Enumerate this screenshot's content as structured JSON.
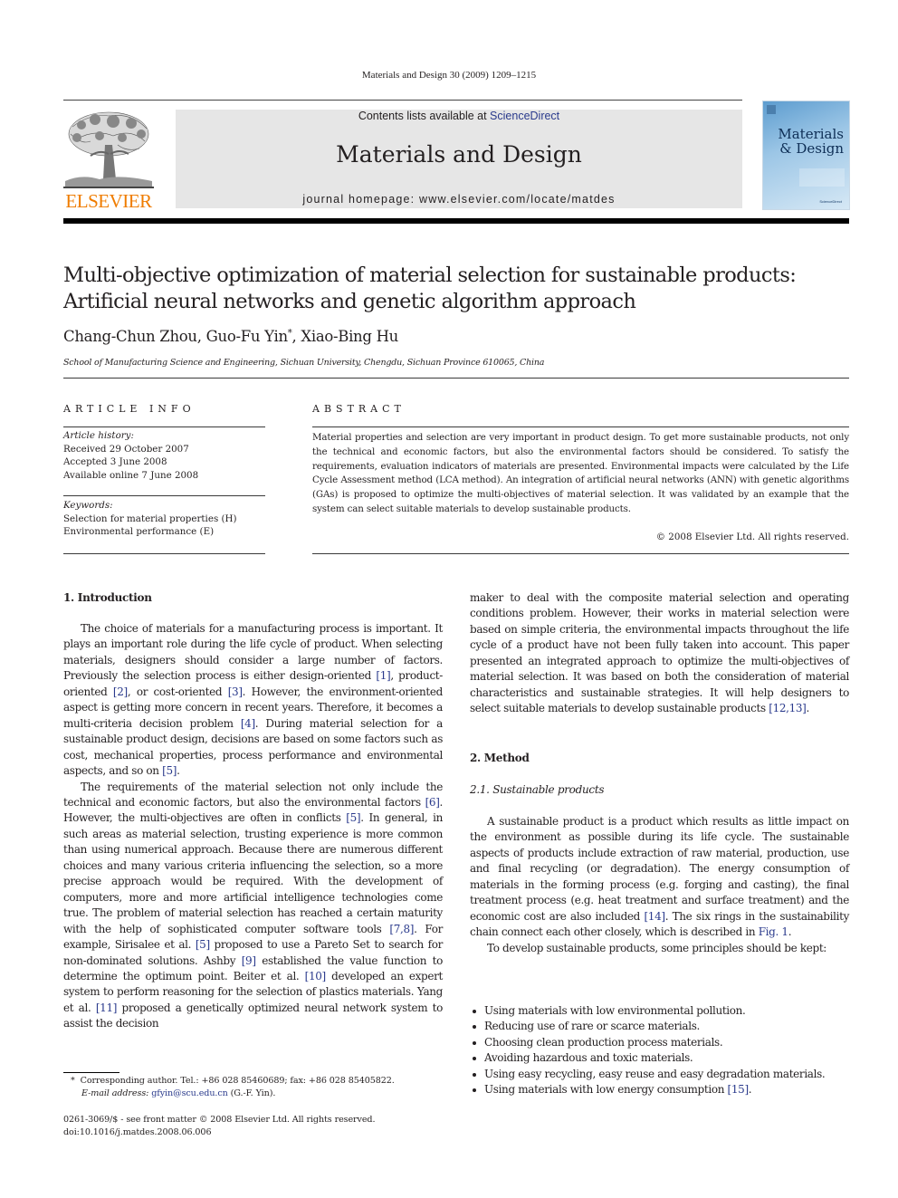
{
  "running_head": "Materials and Design 30 (2009) 1209–1215",
  "masthead": {
    "publisher_logo_text": "ELSEVIER",
    "contents_prefix": "Contents lists available at ",
    "contents_link": "ScienceDirect",
    "journal_name": "Materials and Design",
    "homepage": "journal homepage: www.elsevier.com/locate/matdes",
    "cover_title_line1": "Materials",
    "cover_title_line2": "& Design",
    "cover_publisher": "ScienceDirect",
    "colors": {
      "elsevier_orange": "#ef7c00",
      "link_blue": "#2a3a8c",
      "banner_gray": "#e6e6e6"
    }
  },
  "article": {
    "title_line1": "Multi-objective optimization of material selection for sustainable products:",
    "title_line2": "Artificial neural networks and genetic algorithm approach",
    "authors_before": "Chang-Chun Zhou, Guo-Fu Yin",
    "author_mark": "*",
    "authors_after": ", Xiao-Bing Hu",
    "affiliation": "School of Manufacturing Science and Engineering, Sichuan University, Chengdu, Sichuan Province 610065, China"
  },
  "article_info": {
    "heading": "ARTICLE INFO",
    "history_label": "Article history:",
    "history": [
      "Received 29 October 2007",
      "Accepted 3 June 2008",
      "Available online 7 June 2008"
    ],
    "keywords_label": "Keywords:",
    "keywords": [
      "Selection for material properties (H)",
      "Environmental performance (E)"
    ]
  },
  "abstract": {
    "heading": "ABSTRACT",
    "text": "Material properties and selection are very important in product design. To get more sustainable products, not only the technical and economic factors, but also the environmental factors should be considered. To satisfy the requirements, evaluation indicators of materials are presented. Environmental impacts were calculated by the Life Cycle Assessment method (LCA method). An integration of artificial neural networks (ANN) with genetic algorithms (GAs) is proposed to optimize the multi-objectives of material selection. It was validated by an example that the system can select suitable materials to develop sustainable products.",
    "copyright": "© 2008 Elsevier Ltd. All rights reserved."
  },
  "body": {
    "sec1_heading": "1. Introduction",
    "p1": [
      "The choice of materials for a manufacturing process is important. It plays an important role during the life cycle of product. When selecting materials, designers should consider a large number of factors. Previously the selection process is either design-oriented ",
      "[1]",
      ", product-oriented ",
      "[2]",
      ", or cost-oriented ",
      "[3]",
      ". However, the environment-oriented aspect is getting more concern in recent years. Therefore, it becomes a multi-criteria decision problem ",
      "[4]",
      ". During material selection for a sustainable product design, decisions are based on some factors such as cost, mechanical properties, process performance and environmental aspects, and so on ",
      "[5]",
      "."
    ],
    "p2": [
      "The requirements of the material selection not only include the technical and economic factors, but also the environmental factors ",
      "[6]",
      ". However, the multi-objectives are often in conflicts ",
      "[5]",
      ". In general, in such areas as material selection, trusting experience is more common than using numerical approach. Because there are numerous different choices and many various criteria influencing the selection, so a more precise approach would be required. With the development of computers, more and more artificial intelligence technologies come true. The problem of material selection has reached a certain maturity with the help of sophisticated computer software tools ",
      "[7,8]",
      ". For example, Sirisalee et al. ",
      "[5]",
      " proposed to use a Pareto Set to search for non-dominated solutions. Ashby ",
      "[9]",
      " established the value function to determine the optimum point. Beiter et al. ",
      "[10]",
      " developed an expert system to perform reasoning for the selection of plastics materials. Yang et al. ",
      "[11]",
      " proposed a genetically optimized neural network system to assist the decision"
    ],
    "p3": [
      "maker to deal with the composite material selection and operating conditions problem. However, their works in material selection were based on simple criteria, the environmental impacts throughout the life cycle of a product have not been fully taken into account. This paper presented an integrated approach to optimize the multi-objectives of material selection. It was based on both the consideration of material characteristics and sustainable strategies. It will help designers to select suitable materials to develop sustainable products ",
      "[12,13]",
      "."
    ],
    "sec2_heading": "2. Method",
    "sec21_heading": "2.1. Sustainable products",
    "p4": [
      "A sustainable product is a product which results as little impact on the environment as possible during its life cycle. The sustainable aspects of products include extraction of raw material, production, use and final recycling (or degradation). The energy consumption of materials in the forming process (e.g. forging and casting), the final treatment process (e.g. heat treatment and surface treatment) and the economic cost are also included ",
      "[14]",
      ". The six rings in the sustainability chain connect each other closely, which is described in ",
      "Fig. 1",
      "."
    ],
    "p5": "To develop sustainable products, some principles should be kept:",
    "bullets": [
      [
        "Using materials with low environmental pollution."
      ],
      [
        "Reducing use of rare or scarce materials."
      ],
      [
        "Choosing clean production process materials."
      ],
      [
        "Avoiding hazardous and toxic materials."
      ],
      [
        "Using easy recycling, easy reuse and easy degradation materials."
      ],
      [
        "Using materials with low energy consumption ",
        "[15]",
        "."
      ]
    ]
  },
  "footnote": {
    "mark": "*",
    "corresponding": "Corresponding author. Tel.: +86 028 85460689; fax: +86 028 85405822.",
    "email_label": "E-mail address:",
    "email": "gfyin@scu.edu.cn",
    "email_suffix": " (G.-F. Yin).",
    "issn_line": "0261-3069/$ - see front matter © 2008 Elsevier Ltd. All rights reserved.",
    "doi_line": "doi:10.1016/j.matdes.2008.06.006"
  }
}
